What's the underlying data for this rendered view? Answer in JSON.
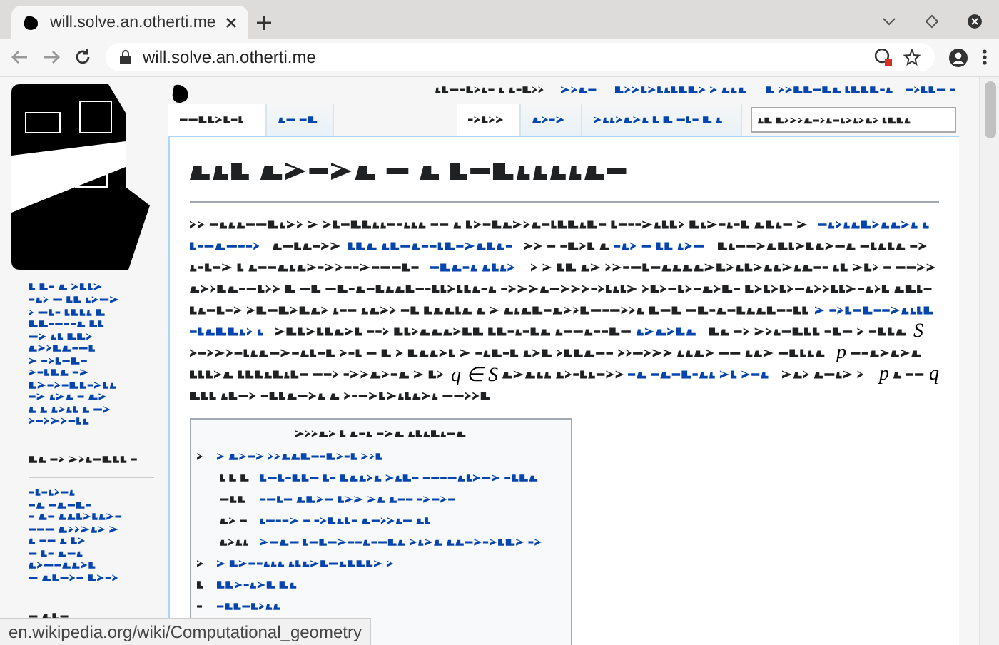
{
  "browser": {
    "tab_title": "will.solve.an.otherti.me",
    "address": "will.solve.an.otherti.me"
  },
  "wiki_tabs": {
    "left": [
      {
        "selected": true
      },
      {
        "selected": false
      }
    ],
    "right": [
      {
        "selected": true
      },
      {
        "selected": false
      },
      {
        "selected": false
      }
    ]
  },
  "article": {
    "math": [
      "S",
      "p",
      "q ∈ S",
      "p",
      "q"
    ]
  },
  "status_bar": "en.wikipedia.org/wiki/Computational_geometry"
}
